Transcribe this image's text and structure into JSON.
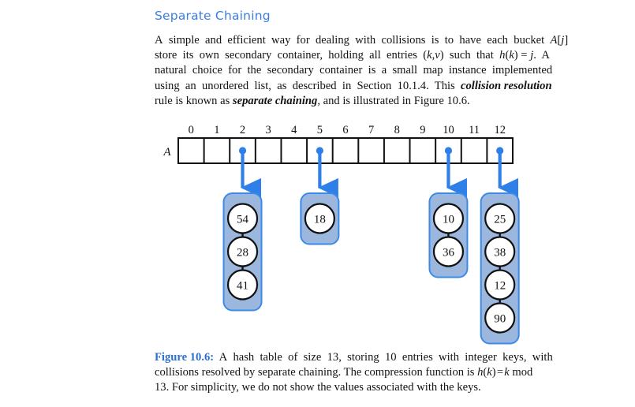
{
  "section": {
    "heading": "Separate Chaining"
  },
  "paragraph": {
    "lines": [
      "A simple and efficient way for dealing with collisions is to have each bucket A[j]",
      "store its own secondary container, holding all entries (k,v) such that h(k) = j. A",
      "natural choice for the secondary container is a small map instance implemented",
      "using an unordered list, as described in Section 10.1.4. This collision resolution",
      "rule is known as separate chaining, and is illustrated in Figure 10.6."
    ]
  },
  "figure": {
    "array_name": "A",
    "indices": [
      "0",
      "1",
      "2",
      "3",
      "4",
      "5",
      "6",
      "7",
      "8",
      "9",
      "10",
      "11",
      "12"
    ],
    "buckets": [
      {
        "index": 2,
        "keys": [
          "54",
          "28",
          "41"
        ]
      },
      {
        "index": 5,
        "keys": [
          "18"
        ]
      },
      {
        "index": 10,
        "keys": [
          "10",
          "36"
        ]
      },
      {
        "index": 12,
        "keys": [
          "25",
          "38",
          "12",
          "90"
        ]
      }
    ],
    "colors": {
      "bucket_fill": "#9cb7dd",
      "bucket_stroke": "#3c8ae8",
      "arrow": "#2f7fe8",
      "array_stroke": "#111111",
      "node_fill": "#ffffff",
      "node_stroke": "#111111",
      "heading": "#3b7de0",
      "caption_label": "#2f6fd0"
    }
  },
  "caption": {
    "label": "Figure 10.6:",
    "lines": [
      "A hash table of size 13, storing 10 entries with integer keys, with",
      "collisions resolved by separate chaining. The compression function is h(k) = k mod",
      "13. For simplicity, we do not show the values associated with the keys."
    ]
  }
}
